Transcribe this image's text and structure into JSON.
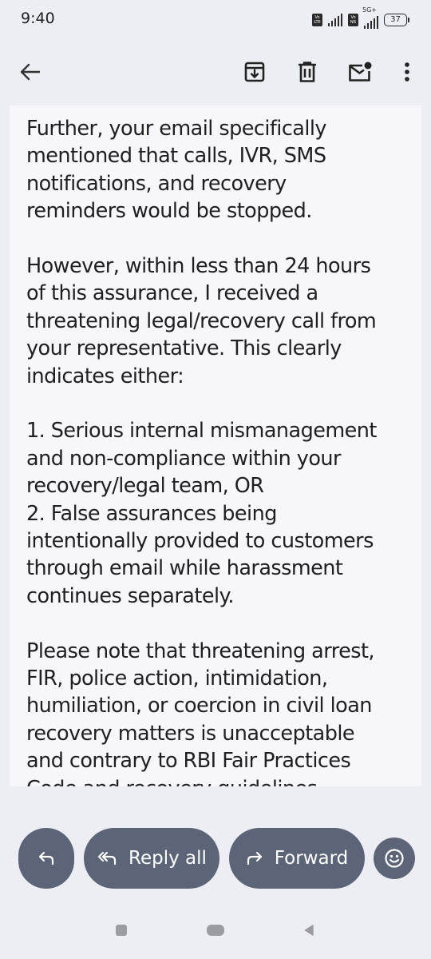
{
  "status_bar": {
    "time": "9:40",
    "sim1_badge": [
      "Vo",
      "LTE"
    ],
    "sim2_badge": [
      "Vo",
      "NR"
    ],
    "network_type": "5G+",
    "battery_level": "37"
  },
  "toolbar": {
    "back_icon": "arrow-left-icon",
    "archive_icon": "archive-icon",
    "delete_icon": "trash-icon",
    "unread_icon": "mark-unread-icon",
    "more_icon": "more-vertical-icon"
  },
  "email": {
    "paragraphs": [
      {
        "lines": [
          "Further, your email specifically",
          "mentioned that calls, IVR, SMS",
          "notifications, and recovery",
          "reminders would be stopped."
        ]
      },
      {
        "lines": [
          "However, within less than 24 hours",
          "of this assurance, I received a",
          "threatening legal/recovery call from",
          "your representative. This clearly",
          "indicates either:"
        ]
      },
      {
        "lines": [
          "1. Serious internal mismanagement",
          "and non-compliance within your",
          "recovery/legal team, OR",
          "2. False assurances being",
          "intentionally provided to customers",
          "through email while harassment",
          "continues separately."
        ]
      },
      {
        "lines": [
          "Please note that threatening arrest,",
          "FIR, police action, intimidation,",
          "humiliation, or coercion in civil loan",
          "recovery matters is unacceptable",
          "and contrary to RBI Fair Practices",
          "Code and recovery guidelines."
        ]
      }
    ]
  },
  "actions": {
    "reply_icon": "reply-icon",
    "reply_all_label": "Reply all",
    "reply_all_icon": "reply-all-icon",
    "forward_label": "Forward",
    "forward_icon": "forward-icon",
    "emoji_icon": "emoji-icon"
  },
  "colors": {
    "page_background": "#eceef3",
    "card_background": "#f6f6fb",
    "action_button": "#5b6577",
    "text": "#1f1f1f"
  }
}
